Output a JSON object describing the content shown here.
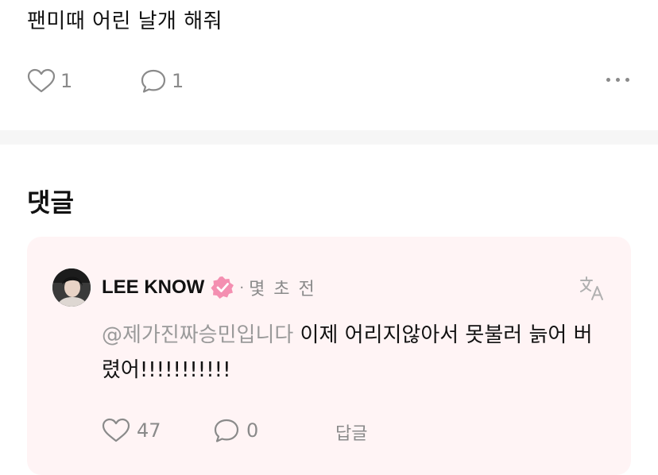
{
  "post": {
    "text": "팬미때 어린 날개 해줘",
    "likes": "1",
    "comments": "1"
  },
  "comments_section": {
    "heading": "댓글"
  },
  "comment": {
    "author": "LEE KNOW",
    "dot": "·",
    "time": "몇 초 전",
    "mention": "@제가진짜승민입니다",
    "text": " 이제 어리지않아서 못불러 늙어 버렸어!!!!!!!!!!!",
    "likes": "47",
    "replies": "0",
    "reply_label": "답글"
  },
  "colors": {
    "card_bg": "#fff4f5",
    "verified": "#f48fb1",
    "muted": "#8a8a8a"
  },
  "icons": [
    "heart-icon",
    "comment-icon",
    "more-icon",
    "verified-badge-icon",
    "translate-icon"
  ]
}
